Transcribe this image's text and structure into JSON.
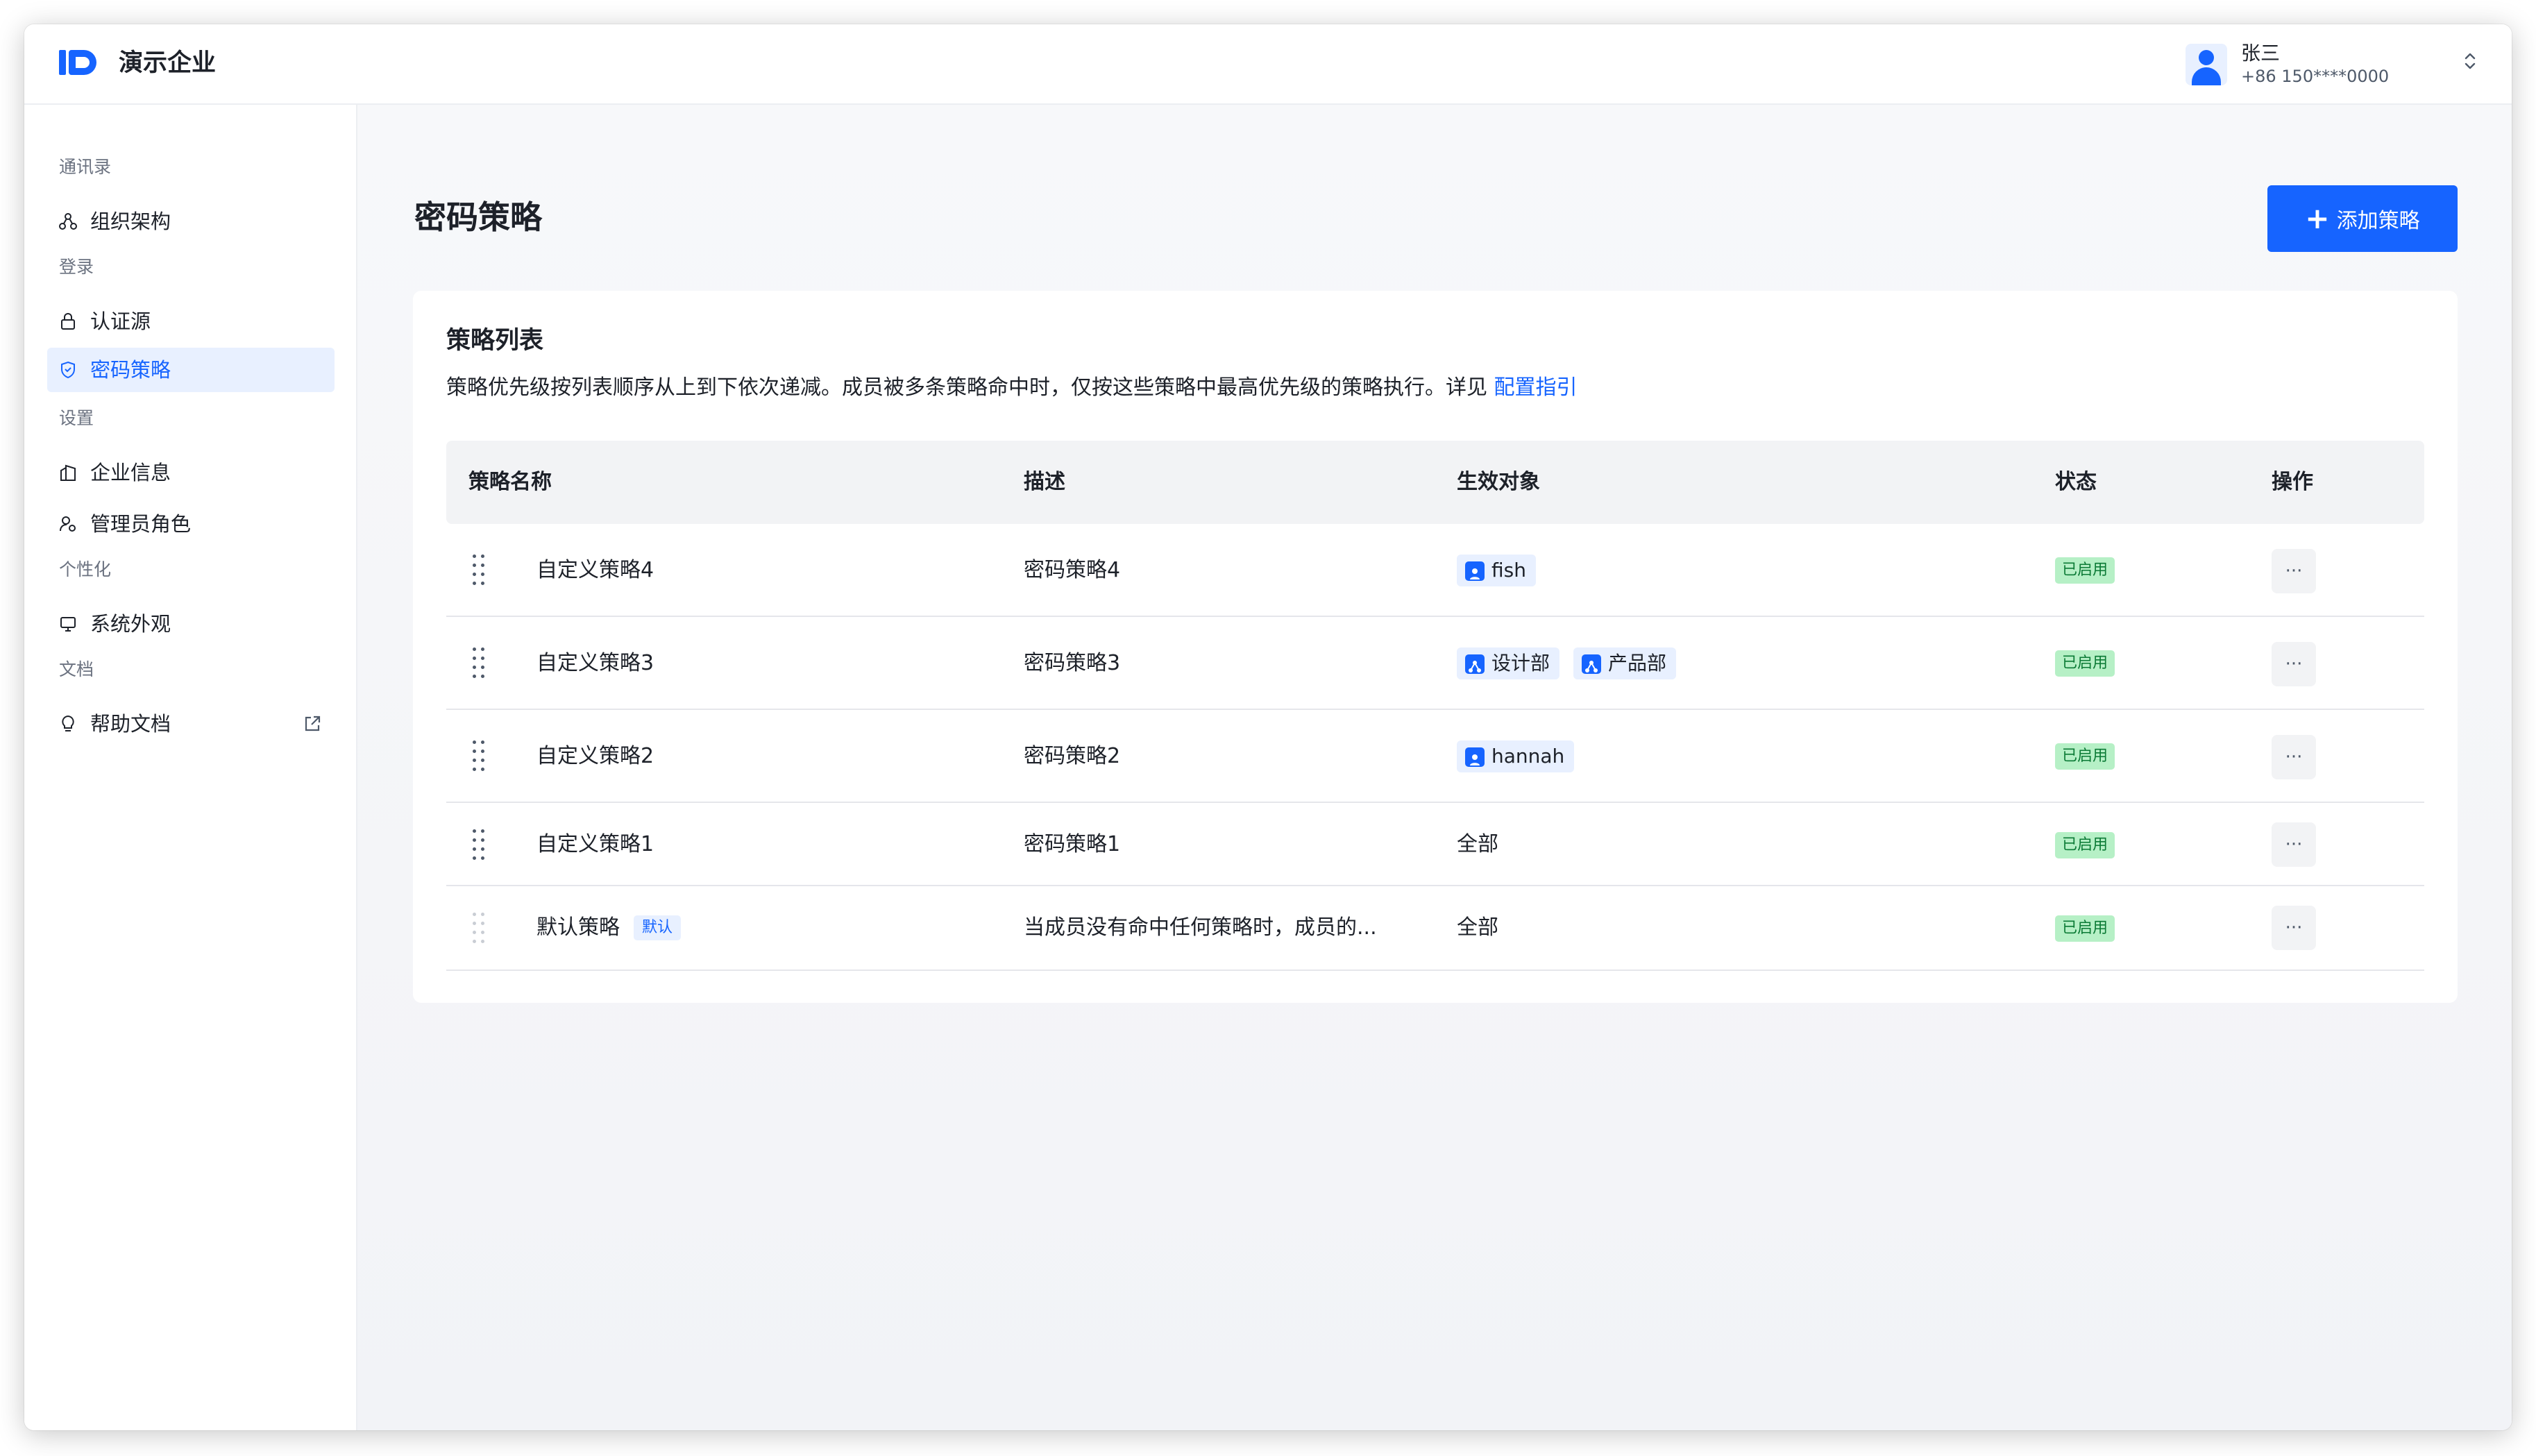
{
  "app": {
    "org_name": "演示企业"
  },
  "user": {
    "name": "张三",
    "phone": "+86 150****0000"
  },
  "sidebar": {
    "sections": [
      {
        "title": "通讯录"
      },
      {
        "title": "登录"
      },
      {
        "title": "设置"
      },
      {
        "title": "个性化"
      },
      {
        "title": "文档"
      }
    ],
    "items": [
      {
        "label": "组织架构",
        "icon": "org-structure-icon"
      },
      {
        "label": "认证源",
        "icon": "lock-icon"
      },
      {
        "label": "密码策略",
        "icon": "shield-icon",
        "active": true
      },
      {
        "label": "企业信息",
        "icon": "building-icon"
      },
      {
        "label": "管理员角色",
        "icon": "admin-role-icon"
      },
      {
        "label": "系统外观",
        "icon": "monitor-icon"
      },
      {
        "label": "帮助文档",
        "icon": "lightbulb-icon",
        "external": true
      }
    ]
  },
  "main": {
    "title": "密码策略",
    "add_button": "添加策略",
    "card": {
      "title": "策略列表",
      "desc": "策略优先级按列表顺序从上到下依次递减。成员被多条策略命中时，仅按这些策略中最高优先级的策略执行。详见",
      "link": "配置指引"
    },
    "table": {
      "headers": [
        "策略名称",
        "描述",
        "生效对象",
        "状态",
        "操作"
      ],
      "rows": [
        {
          "name": "自定义策略4",
          "desc": "密码策略4",
          "targets": [
            {
              "label": "fish",
              "type": "user"
            }
          ],
          "target_text": "",
          "status": "已启用",
          "action": "···"
        },
        {
          "name": "自定义策略3",
          "desc": "密码策略3",
          "targets": [
            {
              "label": "设计部",
              "type": "dept"
            },
            {
              "label": "产品部",
              "type": "dept"
            }
          ],
          "target_text": "",
          "status": "已启用",
          "action": "···"
        },
        {
          "name": "自定义策略2",
          "desc": "密码策略2",
          "targets": [
            {
              "label": "hannah",
              "type": "user"
            }
          ],
          "target_text": "",
          "status": "已启用",
          "action": "···"
        },
        {
          "name": "自定义策略1",
          "desc": "密码策略1",
          "targets": [],
          "target_text": "全部",
          "status": "已启用",
          "action": "···"
        },
        {
          "name": "默认策略",
          "badge": "默认",
          "desc": "当成员没有命中任何策略时，成员的...",
          "targets": [],
          "target_text": "全部",
          "status": "已启用",
          "action": "···"
        }
      ]
    }
  },
  "colors": {
    "accent": "#1664ff",
    "status_bg": "#b6f0c6",
    "status_text": "#0b7a35"
  }
}
